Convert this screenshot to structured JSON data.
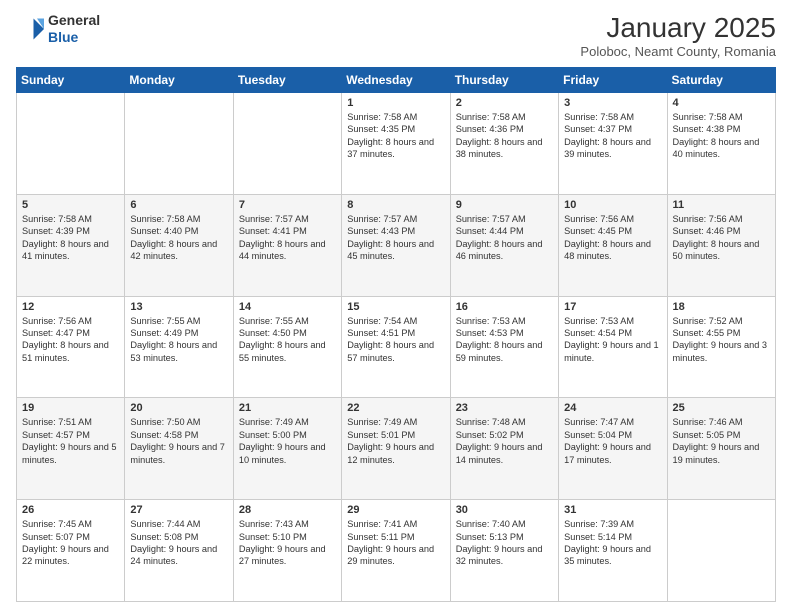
{
  "header": {
    "logo_line1": "General",
    "logo_line2": "Blue",
    "month": "January 2025",
    "location": "Poloboc, Neamt County, Romania"
  },
  "weekdays": [
    "Sunday",
    "Monday",
    "Tuesday",
    "Wednesday",
    "Thursday",
    "Friday",
    "Saturday"
  ],
  "weeks": [
    [
      {
        "day": "",
        "info": ""
      },
      {
        "day": "",
        "info": ""
      },
      {
        "day": "",
        "info": ""
      },
      {
        "day": "1",
        "info": "Sunrise: 7:58 AM\nSunset: 4:35 PM\nDaylight: 8 hours\nand 37 minutes."
      },
      {
        "day": "2",
        "info": "Sunrise: 7:58 AM\nSunset: 4:36 PM\nDaylight: 8 hours\nand 38 minutes."
      },
      {
        "day": "3",
        "info": "Sunrise: 7:58 AM\nSunset: 4:37 PM\nDaylight: 8 hours\nand 39 minutes."
      },
      {
        "day": "4",
        "info": "Sunrise: 7:58 AM\nSunset: 4:38 PM\nDaylight: 8 hours\nand 40 minutes."
      }
    ],
    [
      {
        "day": "5",
        "info": "Sunrise: 7:58 AM\nSunset: 4:39 PM\nDaylight: 8 hours\nand 41 minutes."
      },
      {
        "day": "6",
        "info": "Sunrise: 7:58 AM\nSunset: 4:40 PM\nDaylight: 8 hours\nand 42 minutes."
      },
      {
        "day": "7",
        "info": "Sunrise: 7:57 AM\nSunset: 4:41 PM\nDaylight: 8 hours\nand 44 minutes."
      },
      {
        "day": "8",
        "info": "Sunrise: 7:57 AM\nSunset: 4:43 PM\nDaylight: 8 hours\nand 45 minutes."
      },
      {
        "day": "9",
        "info": "Sunrise: 7:57 AM\nSunset: 4:44 PM\nDaylight: 8 hours\nand 46 minutes."
      },
      {
        "day": "10",
        "info": "Sunrise: 7:56 AM\nSunset: 4:45 PM\nDaylight: 8 hours\nand 48 minutes."
      },
      {
        "day": "11",
        "info": "Sunrise: 7:56 AM\nSunset: 4:46 PM\nDaylight: 8 hours\nand 50 minutes."
      }
    ],
    [
      {
        "day": "12",
        "info": "Sunrise: 7:56 AM\nSunset: 4:47 PM\nDaylight: 8 hours\nand 51 minutes."
      },
      {
        "day": "13",
        "info": "Sunrise: 7:55 AM\nSunset: 4:49 PM\nDaylight: 8 hours\nand 53 minutes."
      },
      {
        "day": "14",
        "info": "Sunrise: 7:55 AM\nSunset: 4:50 PM\nDaylight: 8 hours\nand 55 minutes."
      },
      {
        "day": "15",
        "info": "Sunrise: 7:54 AM\nSunset: 4:51 PM\nDaylight: 8 hours\nand 57 minutes."
      },
      {
        "day": "16",
        "info": "Sunrise: 7:53 AM\nSunset: 4:53 PM\nDaylight: 8 hours\nand 59 minutes."
      },
      {
        "day": "17",
        "info": "Sunrise: 7:53 AM\nSunset: 4:54 PM\nDaylight: 9 hours\nand 1 minute."
      },
      {
        "day": "18",
        "info": "Sunrise: 7:52 AM\nSunset: 4:55 PM\nDaylight: 9 hours\nand 3 minutes."
      }
    ],
    [
      {
        "day": "19",
        "info": "Sunrise: 7:51 AM\nSunset: 4:57 PM\nDaylight: 9 hours\nand 5 minutes."
      },
      {
        "day": "20",
        "info": "Sunrise: 7:50 AM\nSunset: 4:58 PM\nDaylight: 9 hours\nand 7 minutes."
      },
      {
        "day": "21",
        "info": "Sunrise: 7:49 AM\nSunset: 5:00 PM\nDaylight: 9 hours\nand 10 minutes."
      },
      {
        "day": "22",
        "info": "Sunrise: 7:49 AM\nSunset: 5:01 PM\nDaylight: 9 hours\nand 12 minutes."
      },
      {
        "day": "23",
        "info": "Sunrise: 7:48 AM\nSunset: 5:02 PM\nDaylight: 9 hours\nand 14 minutes."
      },
      {
        "day": "24",
        "info": "Sunrise: 7:47 AM\nSunset: 5:04 PM\nDaylight: 9 hours\nand 17 minutes."
      },
      {
        "day": "25",
        "info": "Sunrise: 7:46 AM\nSunset: 5:05 PM\nDaylight: 9 hours\nand 19 minutes."
      }
    ],
    [
      {
        "day": "26",
        "info": "Sunrise: 7:45 AM\nSunset: 5:07 PM\nDaylight: 9 hours\nand 22 minutes."
      },
      {
        "day": "27",
        "info": "Sunrise: 7:44 AM\nSunset: 5:08 PM\nDaylight: 9 hours\nand 24 minutes."
      },
      {
        "day": "28",
        "info": "Sunrise: 7:43 AM\nSunset: 5:10 PM\nDaylight: 9 hours\nand 27 minutes."
      },
      {
        "day": "29",
        "info": "Sunrise: 7:41 AM\nSunset: 5:11 PM\nDaylight: 9 hours\nand 29 minutes."
      },
      {
        "day": "30",
        "info": "Sunrise: 7:40 AM\nSunset: 5:13 PM\nDaylight: 9 hours\nand 32 minutes."
      },
      {
        "day": "31",
        "info": "Sunrise: 7:39 AM\nSunset: 5:14 PM\nDaylight: 9 hours\nand 35 minutes."
      },
      {
        "day": "",
        "info": ""
      }
    ]
  ]
}
